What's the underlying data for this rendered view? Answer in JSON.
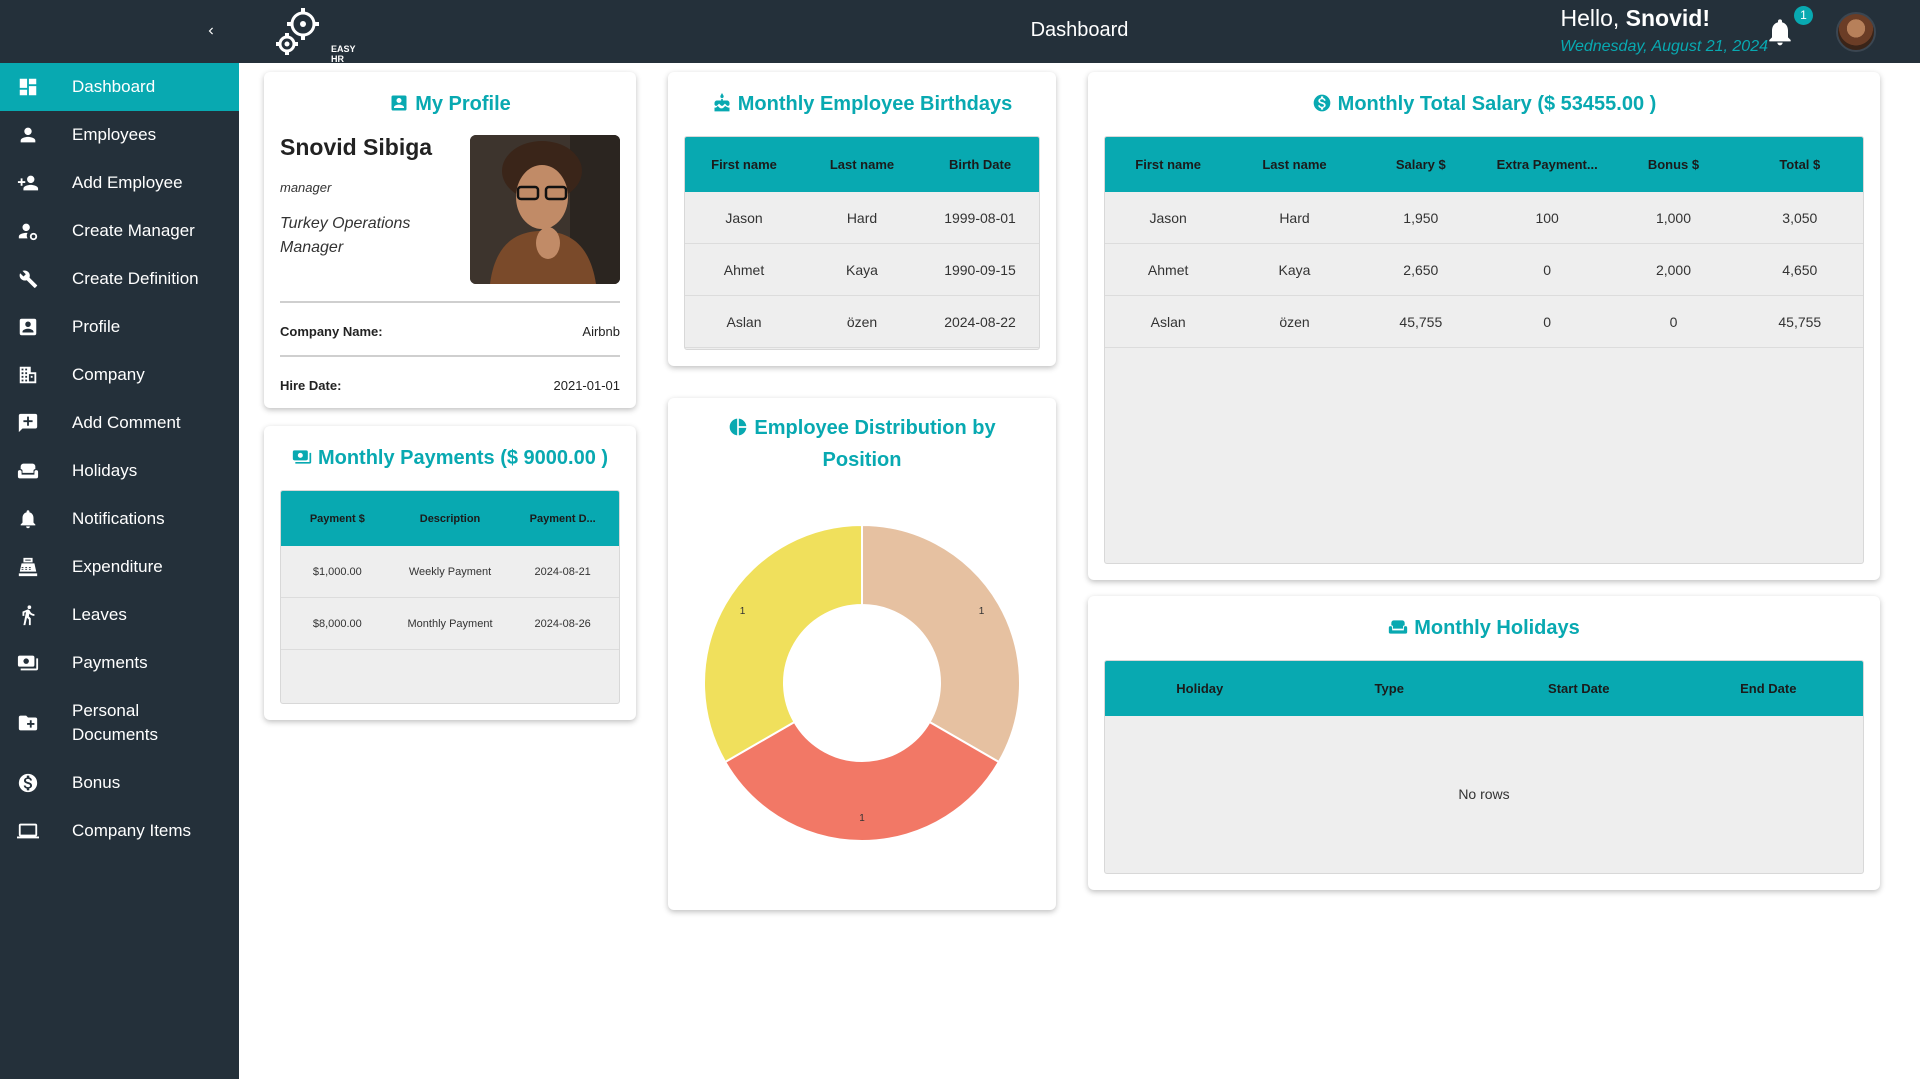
{
  "sidebar": {
    "items": [
      {
        "label": "Dashboard",
        "icon": "dashboard-icon"
      },
      {
        "label": "Employees",
        "icon": "person-icon"
      },
      {
        "label": "Add Employee",
        "icon": "person-add-icon"
      },
      {
        "label": "Create Manager",
        "icon": "manager-icon"
      },
      {
        "label": "Create Definition",
        "icon": "tools-icon"
      },
      {
        "label": "Profile",
        "icon": "profile-icon"
      },
      {
        "label": "Company",
        "icon": "building-icon"
      },
      {
        "label": "Add Comment",
        "icon": "comment-add-icon"
      },
      {
        "label": "Holidays",
        "icon": "sofa-icon"
      },
      {
        "label": "Notifications",
        "icon": "bell-icon"
      },
      {
        "label": "Expenditure",
        "icon": "register-icon"
      },
      {
        "label": "Leaves",
        "icon": "walking-icon"
      },
      {
        "label": "Payments",
        "icon": "payments-icon"
      },
      {
        "label": "Personal Documents",
        "icon": "folder-add-icon"
      },
      {
        "label": "Bonus",
        "icon": "dollar-circle-icon"
      },
      {
        "label": "Company Items",
        "icon": "laptop-icon"
      }
    ],
    "active_index": 0
  },
  "header": {
    "logo_text": "EASY HR",
    "title": "Dashboard",
    "greeting_prefix": "Hello, ",
    "user_name": "Snovid!",
    "date": "Wednesday, August 21, 2024",
    "notification_count": "1"
  },
  "profile": {
    "title": "My Profile",
    "name": "Snovid Sibiga",
    "role": "manager",
    "job_title": "Turkey Operations Manager",
    "company_label": "Company Name:",
    "company_value": "Airbnb",
    "hire_label": "Hire Date:",
    "hire_value": "2021-01-01"
  },
  "payments": {
    "title": "Monthly Payments ($ 9000.00 )",
    "columns": [
      "Payment $",
      "Description",
      "Payment D..."
    ],
    "rows": [
      [
        "$1,000.00",
        "Weekly Payment",
        "2024-08-21"
      ],
      [
        "$8,000.00",
        "Monthly Payment",
        "2024-08-26"
      ]
    ]
  },
  "birthdays": {
    "title": "Monthly Employee Birthdays",
    "columns": [
      "First name",
      "Last name",
      "Birth Date"
    ],
    "rows": [
      [
        "Jason",
        "Hard",
        "1999-08-01"
      ],
      [
        "Ahmet",
        "Kaya",
        "1990-09-15"
      ],
      [
        "Aslan",
        "özen",
        "2024-08-22"
      ]
    ]
  },
  "distribution": {
    "title_line1": "Employee Distribution by",
    "title_line2": "Position"
  },
  "chart_data": {
    "type": "pie",
    "categories": [
      "",
      "",
      ""
    ],
    "values": [
      1,
      1,
      1
    ],
    "colors": [
      "#e6c1a1",
      "#f27866",
      "#f0e05c"
    ],
    "donut": true
  },
  "salary": {
    "title": "Monthly Total Salary ($ 53455.00 )",
    "columns": [
      "First name",
      "Last name",
      "Salary $",
      "Extra Payment...",
      "Bonus $",
      "Total $"
    ],
    "rows": [
      [
        "Jason",
        "Hard",
        "1,950",
        "100",
        "1,000",
        "3,050"
      ],
      [
        "Ahmet",
        "Kaya",
        "2,650",
        "0",
        "2,000",
        "4,650"
      ],
      [
        "Aslan",
        "özen",
        "45,755",
        "0",
        "0",
        "45,755"
      ]
    ]
  },
  "holidays": {
    "title": "Monthly Holidays",
    "columns": [
      "Holiday",
      "Type",
      "Start Date",
      "End Date"
    ],
    "empty_text": "No rows"
  },
  "colors": {
    "accent": "#08a9b1",
    "sidebar_bg": "#24303a",
    "grid_bg": "#eeeeee"
  }
}
